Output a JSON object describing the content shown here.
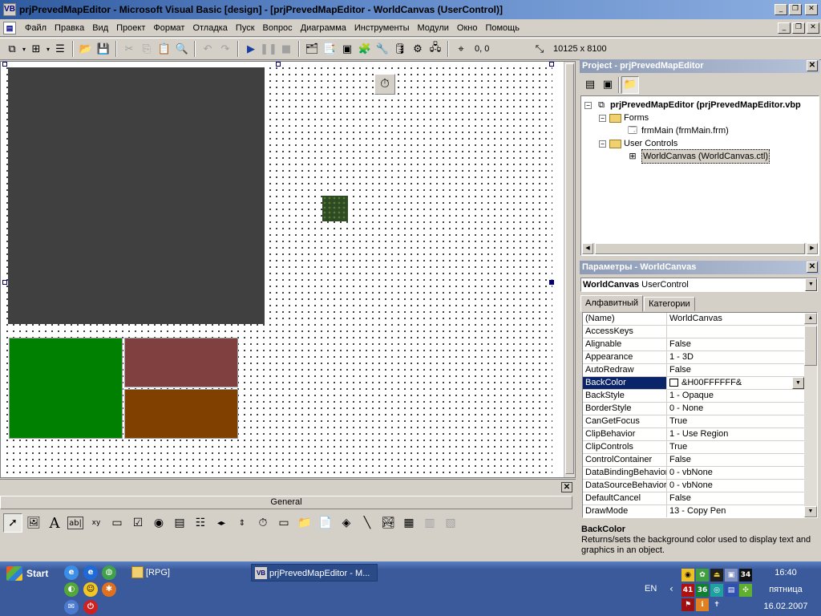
{
  "window": {
    "title": "prjPrevedMapEditor - Microsoft Visual Basic [design] - [prjPrevedMapEditor - WorldCanvas (UserControl)]",
    "caption_buttons": [
      "_",
      "❐",
      "✕"
    ]
  },
  "menu": {
    "items": [
      "Файл",
      "Правка",
      "Вид",
      "Проект",
      "Формат",
      "Отладка",
      "Пуск",
      "Вопрос",
      "Диаграмма",
      "Инструменты",
      "Модули",
      "Окно",
      "Помощь"
    ],
    "mdi_buttons": [
      "_",
      "❐",
      "✕"
    ]
  },
  "toolbar": {
    "position": "0, 0",
    "size": "10125 x 8100"
  },
  "designer": {
    "colors": {
      "dark_panel": "#404040",
      "green": "#008000",
      "rose": "#804040",
      "brown": "#804000"
    }
  },
  "toolbox": {
    "title": "General",
    "close": "✕"
  },
  "project_panel": {
    "title": "Project - prjPrevedMapEditor",
    "tree": [
      {
        "label": "prjPrevedMapEditor (prjPrevedMapEditor.vbp",
        "expander": "−"
      },
      {
        "label": "Forms",
        "expander": "−"
      },
      {
        "label": "frmMain (frmMain.frm)",
        "expander": ""
      },
      {
        "label": "User Controls",
        "expander": "−"
      },
      {
        "label": "WorldCanvas (WorldCanvas.ctl)",
        "expander": ""
      }
    ]
  },
  "properties_panel": {
    "title": "Параметры - WorldCanvas",
    "object_name": "WorldCanvas",
    "object_type": "UserControl",
    "tabs": [
      "Алфавитный",
      "Категории"
    ],
    "rows": [
      {
        "name": "(Name)",
        "value": "WorldCanvas"
      },
      {
        "name": "AccessKeys",
        "value": ""
      },
      {
        "name": "Alignable",
        "value": "False"
      },
      {
        "name": "Appearance",
        "value": "1 - 3D"
      },
      {
        "name": "AutoRedraw",
        "value": "False"
      },
      {
        "name": "BackColor",
        "value": "&H00FFFFFF&"
      },
      {
        "name": "BackStyle",
        "value": "1 - Opaque"
      },
      {
        "name": "BorderStyle",
        "value": "0 - None"
      },
      {
        "name": "CanGetFocus",
        "value": "True"
      },
      {
        "name": "ClipBehavior",
        "value": "1 - Use Region"
      },
      {
        "name": "ClipControls",
        "value": "True"
      },
      {
        "name": "ControlContainer",
        "value": "False"
      },
      {
        "name": "DataBindingBehavior",
        "value": "0 - vbNone"
      },
      {
        "name": "DataSourceBehavior",
        "value": "0 - vbNone"
      },
      {
        "name": "DefaultCancel",
        "value": "False"
      },
      {
        "name": "DrawMode",
        "value": "13 - Copy Pen"
      }
    ],
    "description_title": "BackColor",
    "description_text": "Returns/sets the background color used to display text and graphics in an object."
  },
  "taskbar": {
    "start_label": "Start",
    "items": [
      "[RPG]",
      "prjPrevedMapEditor - M..."
    ],
    "language": "EN",
    "tray_numbers": [
      "34",
      "41",
      "36"
    ],
    "clock_time": "16:40",
    "clock_day": "пятница",
    "clock_date": "16.02.2007"
  }
}
